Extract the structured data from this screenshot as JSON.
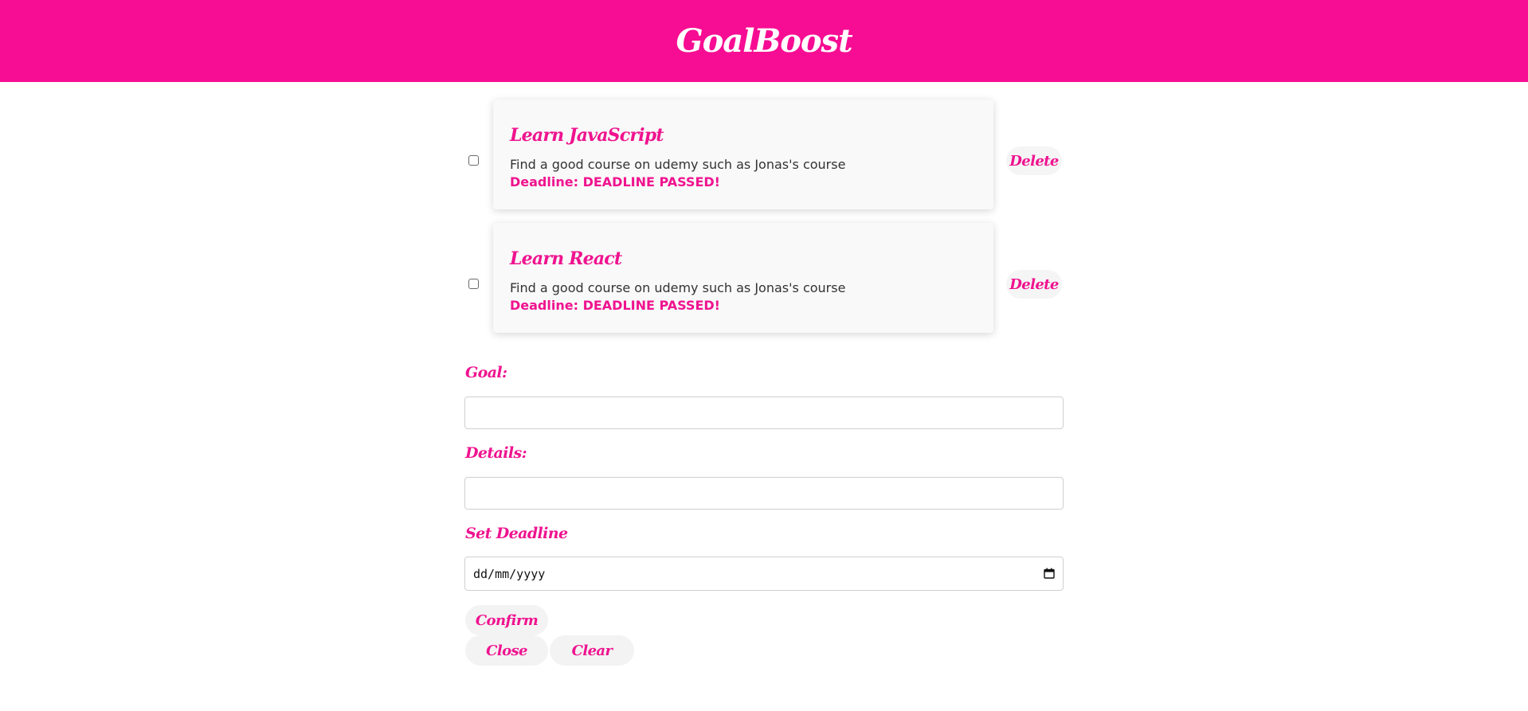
{
  "header": {
    "title": "GoalBoost"
  },
  "goals": [
    {
      "title": "Learn JavaScript",
      "details": "Find a good course on udemy such as Jonas's course",
      "deadline": "Deadline: DEADLINE PASSED!",
      "checked": false,
      "delete_label": "Delete"
    },
    {
      "title": "Learn React",
      "details": "Find a good course on udemy such as Jonas's course",
      "deadline": "Deadline: DEADLINE PASSED!",
      "checked": false,
      "delete_label": "Delete"
    }
  ],
  "form": {
    "goal_label": "Goal:",
    "goal_value": "",
    "details_label": "Details:",
    "details_value": "",
    "deadline_label": "Set Deadline",
    "deadline_placeholder": "dd/mm/yyyy",
    "confirm_label": "Confirm",
    "close_label": "Close",
    "clear_label": "Clear"
  },
  "colors": {
    "brand": "#f70d93",
    "accent_text": "#ef138f",
    "card_background": "#f9f9f9"
  },
  "icons": {
    "date_picker": "calendar-icon"
  }
}
